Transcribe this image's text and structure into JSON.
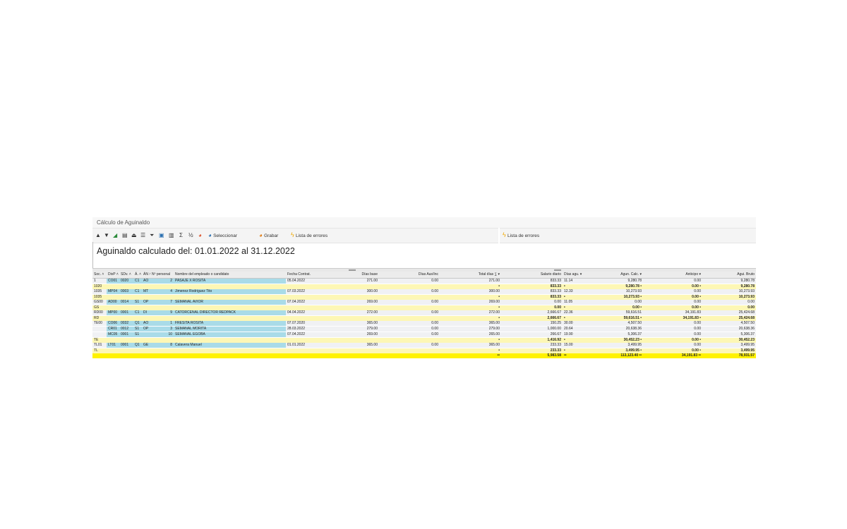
{
  "window": {
    "title": "Cálculo de Aguinaldo"
  },
  "toolbar": {
    "seleccionar_label": "Seleccionar",
    "grabar_label": "Grabar",
    "lista_errores_label": "Lista de errores",
    "lista_errores_right_label": "Lista de errores",
    "sum_glyph": "Σ",
    "subtotal_glyph": "½"
  },
  "report": {
    "title": "Aguinaldo calculado del: 01.01.2022 al 31.12.2022"
  },
  "columns": {
    "soc": "Soc. ˄",
    "divp": "DivP ˄",
    "sdv": "SDv. ˄",
    "a": "Á. ˄",
    "an": "ÁN ˄",
    "nper": "Nº personal",
    "nombre": "Nombre del empleado o candidato",
    "fecha": "Fecha Contrat.",
    "dias_base": "Días base",
    "dias_aus": "Días Aus/Inc",
    "total_dias": "Total días ∑ ▾",
    "salario": "Salario diario",
    "dias_agu": "Días agu. ▾",
    "agu_calc": "Agun. Calc. ▾",
    "anticipo": "Anticipo ▾",
    "agu_bruto": "Agui. Bruto"
  },
  "rows": [
    {
      "type": "data",
      "soc": "1",
      "divp": "CO01",
      "sdv": "0020",
      "a": "C1",
      "an": "AO",
      "nper": "2",
      "nombre": "PASAJE X ROSITA",
      "fecha": "05.04.2022",
      "dias_base": "271.00",
      "dias_aus": "0.00",
      "total_dias": "271.00",
      "salario": "833.33",
      "dias_agu": "11.14",
      "agu_calc": "9,280.78",
      "anticipo": "0.00",
      "agu_bruto": "9,280.78"
    },
    {
      "type": "sub",
      "soc": "1020",
      "total_dias": "•",
      "salario": "833.33",
      "dias_agu": "•",
      "agu_calc": "9,280.78 •",
      "anticipo": "0.00 •",
      "agu_bruto": "9,280.78"
    },
    {
      "type": "data",
      "soc": "1035",
      "divp": "MP04",
      "sdv": "0003",
      "a": "C1",
      "an": "MT",
      "nper": "4",
      "nombre": "Jimenez Rodriguez Tito",
      "fecha": "07.03.2022",
      "dias_base": "300.00",
      "dias_aus": "0.00",
      "total_dias": "300.00",
      "salario": "833.33",
      "dias_agu": "12.33",
      "agu_calc": "10,273.93",
      "anticipo": "0.00",
      "agu_bruto": "10,273.93"
    },
    {
      "type": "sub",
      "soc": "1035",
      "total_dias": "•",
      "salario": "833.33",
      "dias_agu": "•",
      "agu_calc": "10,273.93 •",
      "anticipo": "0.00 •",
      "agu_bruto": "10,273.93"
    },
    {
      "type": "data",
      "soc": "GS00",
      "divp": "AD00",
      "sdv": "0014",
      "a": "S1",
      "an": "OP",
      "nper": "7",
      "nombre": "SEMANAL AVIOR",
      "fecha": "07.04.2022",
      "dias_base": "269.00",
      "dias_aus": "0.00",
      "total_dias": "269.00",
      "salario": "0.00",
      "dias_agu": "11.05",
      "agu_calc": "0.00",
      "anticipo": "0.00",
      "agu_bruto": "0.00"
    },
    {
      "type": "sub",
      "soc": "GS",
      "total_dias": "•",
      "salario": "0.00",
      "dias_agu": "•",
      "agu_calc": "0.00 •",
      "anticipo": "0.00 •",
      "agu_bruto": "0.00"
    },
    {
      "type": "data",
      "soc": "RD00",
      "divp": "MP00",
      "sdv": "0001",
      "a": "C1",
      "an": "DI",
      "nper": "9",
      "nombre": "CATORCENAL DIRECTOR REDPACK",
      "fecha": "04.04.2022",
      "dias_base": "272.00",
      "dias_aus": "0.00",
      "total_dias": "272.00",
      "salario": "2,666.67",
      "dias_agu": "22.36",
      "agu_calc": "59,616.51",
      "anticipo": "34,191.83",
      "agu_bruto": "25,424.68"
    },
    {
      "type": "sub",
      "soc": "RD",
      "total_dias": "•",
      "salario": "2,666.67",
      "dias_agu": "•",
      "agu_calc": "59,616.51 •",
      "anticipo": "34,191.83 •",
      "agu_bruto": "25,424.68"
    },
    {
      "type": "data",
      "soc": "TE00",
      "divp": "CO06",
      "sdv": "0032",
      "a": "Q1",
      "an": "AO",
      "nper": "1",
      "nombre": "FRESITA ROSITA",
      "fecha": "07.07.2020",
      "dias_base": "365.00",
      "dias_aus": "0.00",
      "total_dias": "365.00",
      "salario": "150.25",
      "dias_agu": "30.00",
      "agu_calc": "4,507.50",
      "anticipo": "0.00",
      "agu_bruto": "4,507.50"
    },
    {
      "type": "data",
      "soc": "",
      "divp": "CR01",
      "sdv": "0012",
      "a": "S1",
      "an": "OP",
      "nper": "3",
      "nombre": "SEMANAL MORITA",
      "fecha": "28.03.2022",
      "dias_base": "279.00",
      "dias_aus": "0.00",
      "total_dias": "279.00",
      "salario": "1,000.00",
      "dias_agu": "20.64",
      "agu_calc": "20,638.36",
      "anticipo": "0.00",
      "agu_bruto": "20,638.36"
    },
    {
      "type": "data",
      "soc": "",
      "divp": "MC05",
      "sdv": "0001",
      "a": "S1",
      "an": "",
      "nper": "10",
      "nombre": "SEMANAL EGOBA",
      "fecha": "07.04.2022",
      "dias_base": "269.00",
      "dias_aus": "0.00",
      "total_dias": "265.00",
      "salario": "266.67",
      "dias_agu": "19.90",
      "agu_calc": "5,306.37",
      "anticipo": "0.00",
      "agu_bruto": "5,306.37"
    },
    {
      "type": "sub",
      "soc": "TE",
      "total_dias": "•",
      "salario": "1,416.92",
      "dias_agu": "•",
      "agu_calc": "30,452.23 •",
      "anticipo": "0.00 •",
      "agu_bruto": "30,452.23"
    },
    {
      "type": "data",
      "soc": "TL01",
      "divp": "LT01",
      "sdv": "0001",
      "a": "Q1",
      "an": "GE",
      "nper": "8",
      "nombre": "Calavera Manuel",
      "fecha": "01.01.2022",
      "dias_base": "365.00",
      "dias_aus": "0.00",
      "total_dias": "365.00",
      "salario": "233.33",
      "dias_agu": "15.00",
      "agu_calc": "3,499.95",
      "anticipo": "0.00",
      "agu_bruto": "3,499.95"
    },
    {
      "type": "sub",
      "soc": "TL",
      "total_dias": "•",
      "salario": "233.33",
      "dias_agu": "•",
      "agu_calc": "3,499.95 •",
      "anticipo": "0.00 •",
      "agu_bruto": "3,499.95"
    },
    {
      "type": "total",
      "soc": "",
      "total_dias": "••",
      "salario": "5,983.58",
      "dias_agu": "••",
      "agu_calc": "113,123.40 ••",
      "anticipo": "34,191.83 ••",
      "agu_bruto": "78,931.57"
    }
  ],
  "colors": {
    "key_cell": "#a9dbe8",
    "subtotal_row": "#fdf7b5",
    "total_row": "#fff200",
    "bolt": "#f0a800"
  }
}
